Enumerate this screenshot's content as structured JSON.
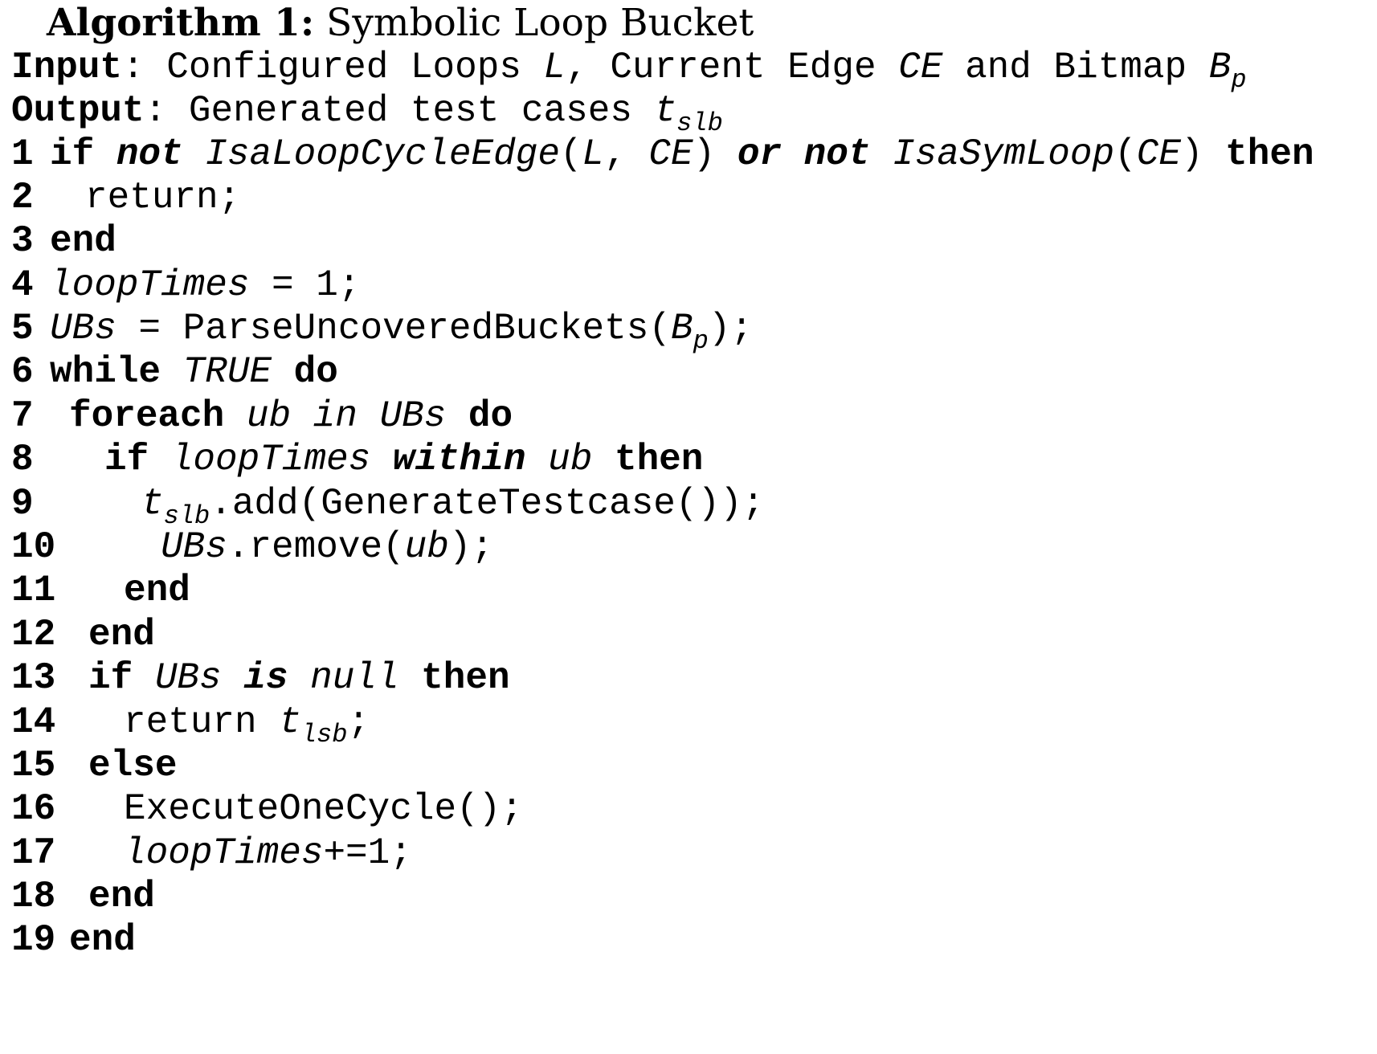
{
  "algorithm": {
    "label": "Algorithm 1:",
    "name": "Symbolic Loop Bucket"
  },
  "io": {
    "input_kw": "Input",
    "input_text": "Configured Loops",
    "L": "L",
    "current_edge": "Current Edge",
    "CE": "CE",
    "and_bitmap": "and Bitmap",
    "B": "B",
    "p": "p",
    "output_kw": "Output",
    "output_text": "Generated test cases",
    "t": "t",
    "slb": "slb"
  },
  "lines": [
    {
      "n": "1",
      "kw_if": "if",
      "not1": "not",
      "func1": "IsaLoopCycleEdge",
      "arg1": "L",
      "arg2": "CE",
      "or_not": "or not",
      "func2": "IsaSymLoop",
      "arg3": "CE",
      "then": "then"
    },
    {
      "n": "2",
      "text": "return;"
    },
    {
      "n": "3",
      "end": "end"
    },
    {
      "n": "4",
      "var": "loopTimes",
      "assign": " = 1;"
    },
    {
      "n": "5",
      "var": "UBs",
      "assign": " = ParseUncoveredBuckets(",
      "B": "B",
      "p": "p",
      "close": ");"
    },
    {
      "n": "6",
      "while": "while",
      "cond": "TRUE",
      "do": "do"
    },
    {
      "n": "7",
      "foreach": "foreach",
      "expr": "ub in UBs",
      "do": "do"
    },
    {
      "n": "8",
      "if": "if",
      "var": "loopTimes",
      "within": "within",
      "ub": "ub",
      "then": "then"
    },
    {
      "n": "9",
      "t": "t",
      "slb": "slb",
      "call": ".add(GenerateTestcase());"
    },
    {
      "n": "10",
      "var": "UBs",
      "call": ".remove(",
      "arg": "ub",
      "close": ");"
    },
    {
      "n": "11",
      "end": "end"
    },
    {
      "n": "12",
      "end": "end"
    },
    {
      "n": "13",
      "if": "if",
      "var": "UBs",
      "is": "is",
      "null": "null",
      "then": "then"
    },
    {
      "n": "14",
      "ret": "return ",
      "t": "t",
      "lsb": "lsb",
      "semi": ";"
    },
    {
      "n": "15",
      "else": "else"
    },
    {
      "n": "16",
      "call": "ExecuteOneCycle();"
    },
    {
      "n": "17",
      "var": "loopTimes",
      "op": "+=1;"
    },
    {
      "n": "18",
      "end": "end"
    },
    {
      "n": "19",
      "end": "end"
    }
  ]
}
